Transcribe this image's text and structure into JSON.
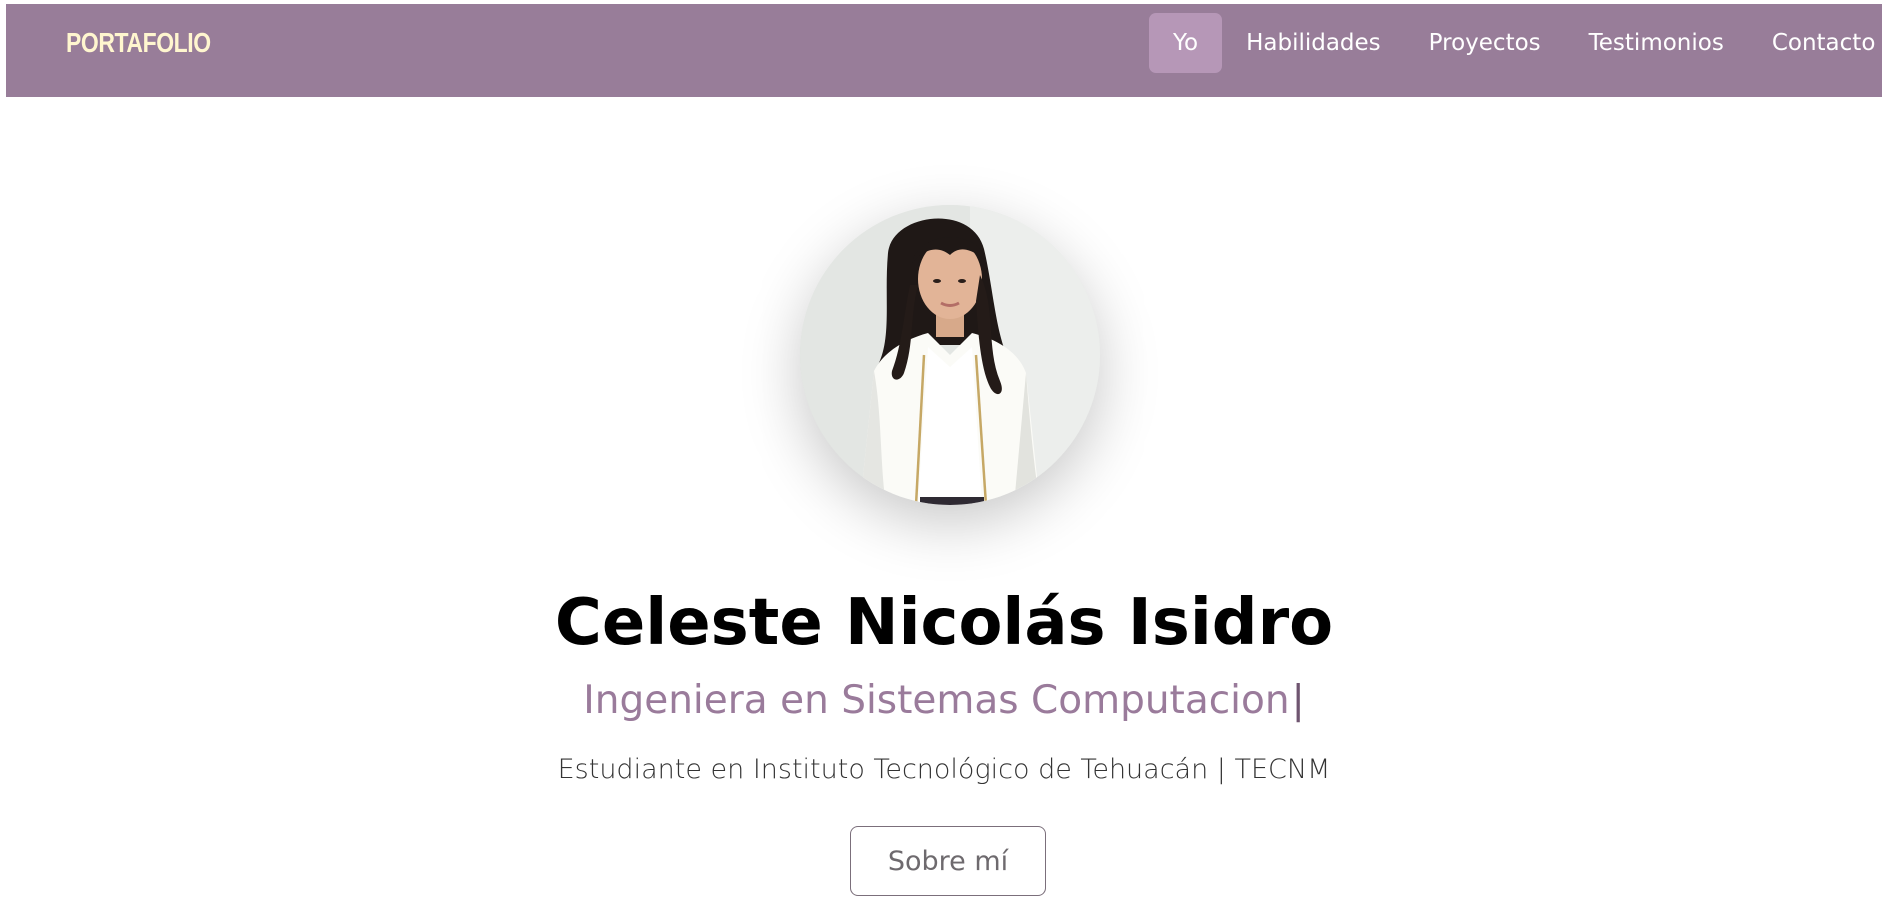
{
  "header": {
    "brand": "PORTAFOLIO",
    "nav": [
      {
        "label": "Yo",
        "active": true
      },
      {
        "label": "Habilidades",
        "active": false
      },
      {
        "label": "Proyectos",
        "active": false
      },
      {
        "label": "Testimonios",
        "active": false
      },
      {
        "label": "Contacto",
        "active": false
      }
    ]
  },
  "hero": {
    "name": "Celeste Nicolás Isidro",
    "role_typed": "Ingeniera en Sistemas Computacion",
    "caret": "|",
    "school": "Estudiante en Instituto Tecnológico de Tehuacán | TECNM",
    "about_button": "Sobre mí"
  },
  "colors": {
    "header_bg": "#987d99",
    "nav_active_bg": "#b697b7",
    "brand_text": "#fff6cf",
    "accent_text": "#9a7b9b"
  }
}
